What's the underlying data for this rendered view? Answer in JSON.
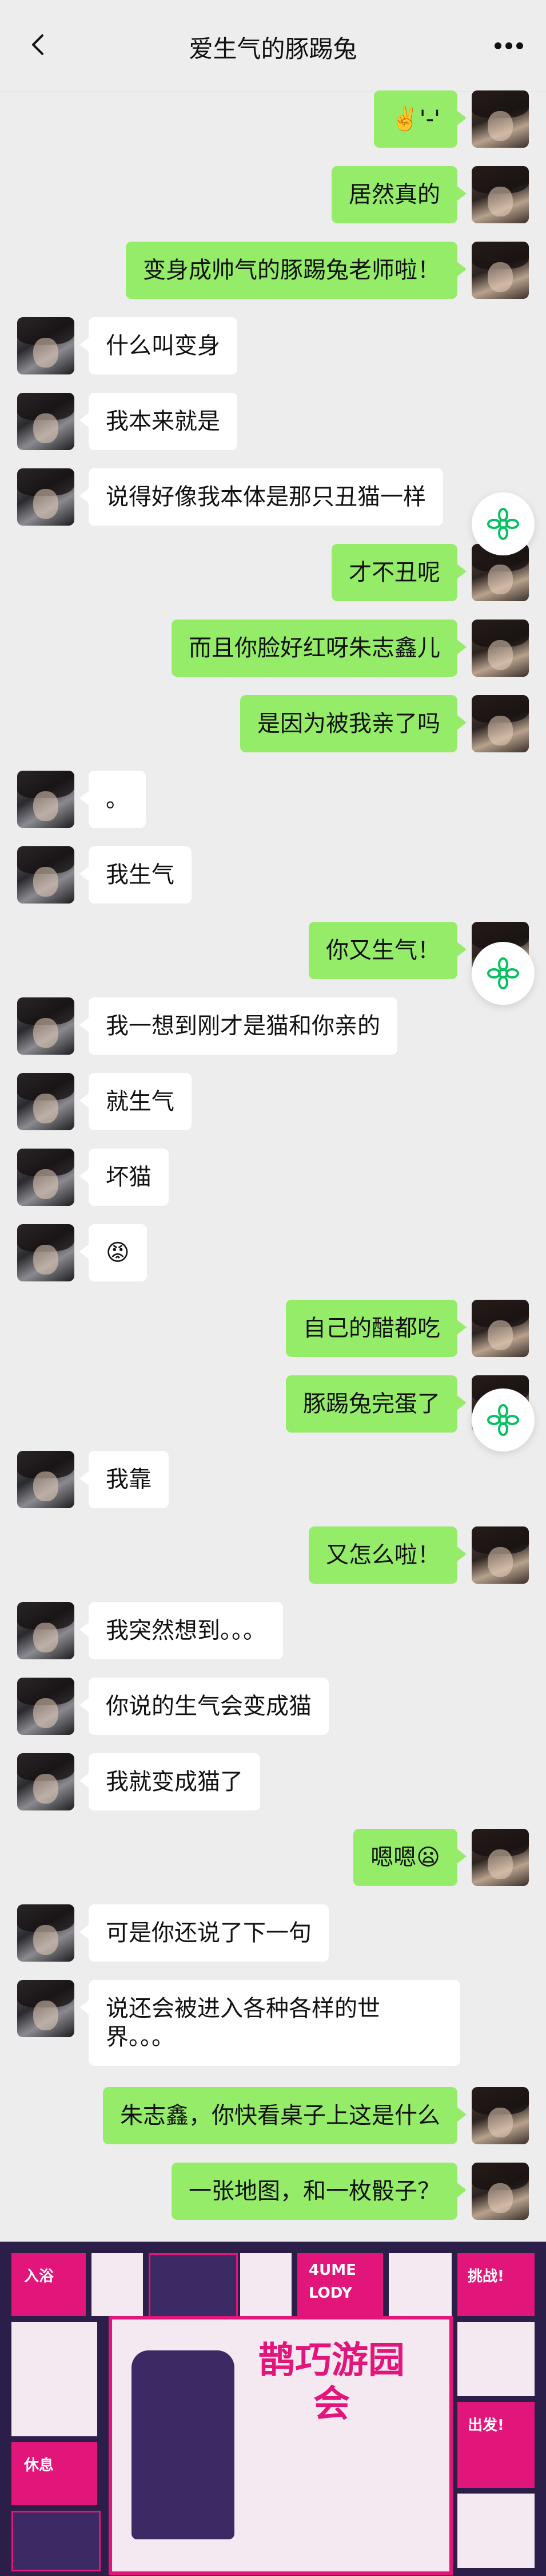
{
  "header": {
    "title": "爱生气的豚踢兔"
  },
  "messages": [
    {
      "side": "me",
      "text": "✌️'-'"
    },
    {
      "side": "me",
      "text": "居然真的"
    },
    {
      "side": "me",
      "text": "变身成帅气的豚踢兔老师啦！"
    },
    {
      "side": "her",
      "text": "什么叫变身"
    },
    {
      "side": "her",
      "text": "我本来就是"
    },
    {
      "side": "her",
      "text": "说得好像我本体是那只丑猫一样"
    },
    {
      "side": "me",
      "text": "才不丑呢"
    },
    {
      "side": "me",
      "text": "而且你脸好红呀朱志鑫儿"
    },
    {
      "side": "me",
      "text": "是因为被我亲了吗"
    },
    {
      "side": "her",
      "text": "。"
    },
    {
      "side": "her",
      "text": "我生气"
    },
    {
      "side": "me",
      "text": "你又生气！"
    },
    {
      "side": "her",
      "text": "我一想到刚才是猫和你亲的"
    },
    {
      "side": "her",
      "text": "就生气"
    },
    {
      "side": "her",
      "text": "坏猫"
    },
    {
      "side": "her",
      "text": "😡"
    },
    {
      "side": "me",
      "text": "自己的醋都吃"
    },
    {
      "side": "me",
      "text": "豚踢兔完蛋了"
    },
    {
      "side": "her",
      "text": "我靠"
    },
    {
      "side": "me",
      "text": "又怎么啦！"
    },
    {
      "side": "her",
      "text": "我突然想到。。。"
    },
    {
      "side": "her",
      "text": "你说的生气会变成猫"
    },
    {
      "side": "her",
      "text": "我就变成猫了"
    },
    {
      "side": "me",
      "text": "嗯嗯😦"
    },
    {
      "side": "her",
      "text": "可是你还说了下一句"
    },
    {
      "side": "her",
      "text": "说还会被进入各种各样的世界。。。"
    },
    {
      "side": "me",
      "text": "朱志鑫，你快看桌子上这是什么"
    },
    {
      "side": "me",
      "text": "一张地图，和一枚骰子？"
    }
  ],
  "poster": {
    "title": "鹊巧游园会",
    "labels": [
      "入浴",
      "挑战!",
      "出发!",
      "休息",
      "4UME",
      "LODY"
    ]
  },
  "icons": {
    "back": "chevron-left-icon",
    "more": "more-dots-icon",
    "float": "flower-icon"
  },
  "colors": {
    "background": "#ededed",
    "my_bubble": "#95ec69",
    "her_bubble": "#ffffff",
    "float_icon": "#07c160"
  }
}
